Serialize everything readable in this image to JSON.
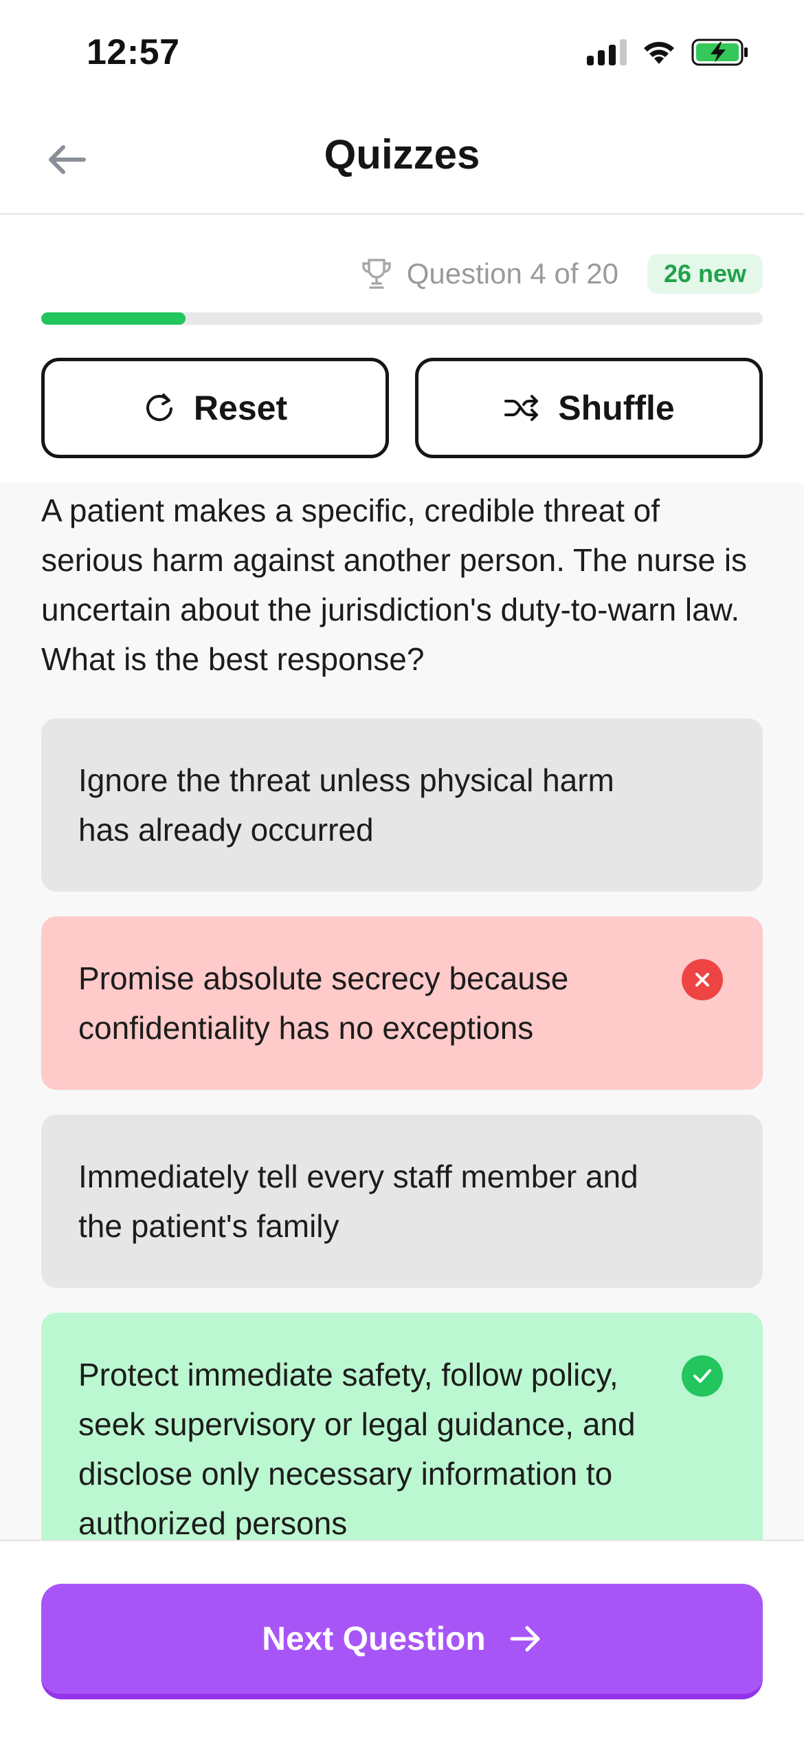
{
  "status_bar": {
    "time": "12:57",
    "icons": [
      "cellular-signal-icon",
      "wifi-icon",
      "battery-charging-icon"
    ]
  },
  "header": {
    "title": "Quizzes",
    "back_icon": "arrow-left-icon"
  },
  "progress": {
    "question_label": "Question 4 of 20",
    "new_badge": "26 new",
    "fraction": 0.2,
    "trophy_icon": "trophy-icon"
  },
  "actions": {
    "reset_label": "Reset",
    "shuffle_label": "Shuffle",
    "reset_icon": "refresh-icon",
    "shuffle_icon": "shuffle-icon"
  },
  "quiz": {
    "question": "A patient makes a specific, credible threat of serious harm against another person. The nurse is uncertain about the jurisdiction's duty-to-warn law. What is the best response?",
    "options": [
      {
        "text": "Ignore the threat unless physical harm has already occurred",
        "state": "neutral"
      },
      {
        "text": "Promise absolute secrecy because confidentiality has no exceptions",
        "state": "wrong"
      },
      {
        "text": "Immediately tell every staff member and the patient's family",
        "state": "neutral"
      },
      {
        "text": "Protect immediate safety, follow policy, seek supervisory or legal guidance, and disclose only necessary information to authorized persons",
        "state": "correct"
      }
    ]
  },
  "footer": {
    "next_label": "Next Question",
    "next_icon": "arrow-right-icon"
  },
  "colors": {
    "accent": "#a855f7",
    "progress": "#22c55e",
    "wrong_bg": "#fecaca",
    "correct_bg": "#bbf7d0",
    "badge_text": "#22a14b"
  }
}
